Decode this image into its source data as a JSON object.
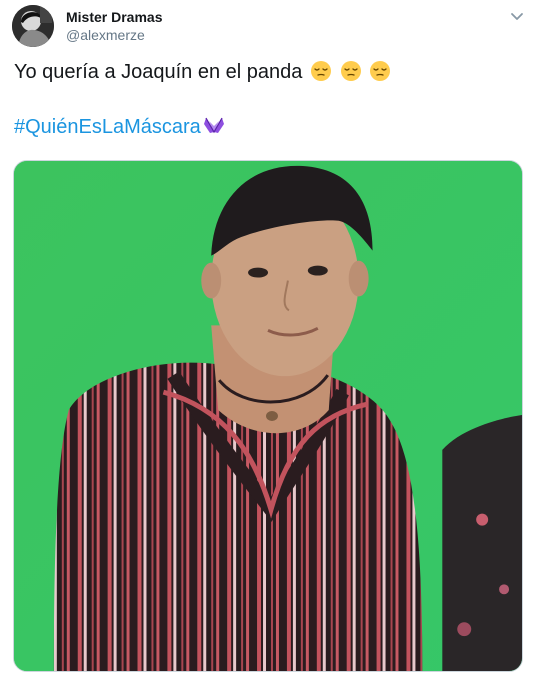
{
  "tweet": {
    "author": {
      "name": "Mister Dramas",
      "handle": "@alexmerze"
    },
    "text": "Yo quería a Joaquín en el panda",
    "emojis": [
      "pensive-face-emoji",
      "pensive-face-emoji",
      "pensive-face-emoji"
    ],
    "hashtag": "#QuiénEsLaMáscara",
    "hashflag_icon": "purple-butterfly-mask-icon",
    "more_icon": "chevron-down-icon"
  },
  "colors": {
    "link_blue": "#1b95e0",
    "handle_gray": "#657786",
    "green_screen": "#3ac662",
    "hashflag_purple": "#7b3fd1"
  }
}
